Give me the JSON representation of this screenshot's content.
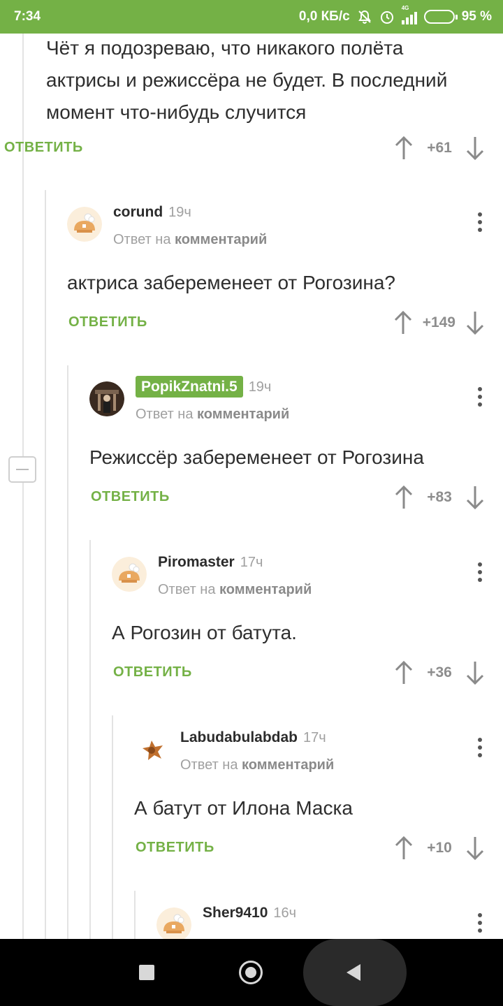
{
  "status_bar": {
    "time": "7:34",
    "network_speed": "0,0 КБ/с",
    "network_type": "4G",
    "battery": "95 %",
    "battery_level": 0.95,
    "icons": [
      "mute-bell-icon",
      "alarm-icon",
      "signal-icon",
      "battery-icon"
    ]
  },
  "colors": {
    "accent": "#74b146",
    "muted": "#a0a0a0",
    "vote_arrow": "#8a8a8a"
  },
  "top_comment": {
    "text": "Чёт я подозреваю, что никакого полёта актрисы и режиссёра не будет. В последний момент что-нибудь случится",
    "reply_label": "ОТВЕТИТЬ",
    "votes": "+61"
  },
  "comments": [
    {
      "user": "corund",
      "time": "19ч",
      "reply_prefix": "Ответ на",
      "reply_link": "комментарий",
      "text": "актриса забеременеет от Рогозина?",
      "reply_label": "ОТВЕТИТЬ",
      "votes": "+149"
    },
    {
      "user": "PopikZnatni.5",
      "time": "19ч",
      "reply_prefix": "Ответ на",
      "reply_link": "комментарий",
      "text": "Режиссёр забеременеет от Рогозина",
      "reply_label": "ОТВЕТИТЬ",
      "votes": "+83"
    },
    {
      "user": "Piromaster",
      "time": "17ч",
      "reply_prefix": "Ответ на",
      "reply_link": "комментарий",
      "text": "А Рогозин от батута.",
      "reply_label": "ОТВЕТИТЬ",
      "votes": "+36"
    },
    {
      "user": "Labudabulabdab",
      "time": "17ч",
      "reply_prefix": "Ответ на",
      "reply_link": "комментарий",
      "text": "А батут от Илона Маска",
      "reply_label": "ОТВЕТИТЬ",
      "votes": "+10"
    },
    {
      "user": "Sher9410",
      "time": "16ч"
    }
  ]
}
